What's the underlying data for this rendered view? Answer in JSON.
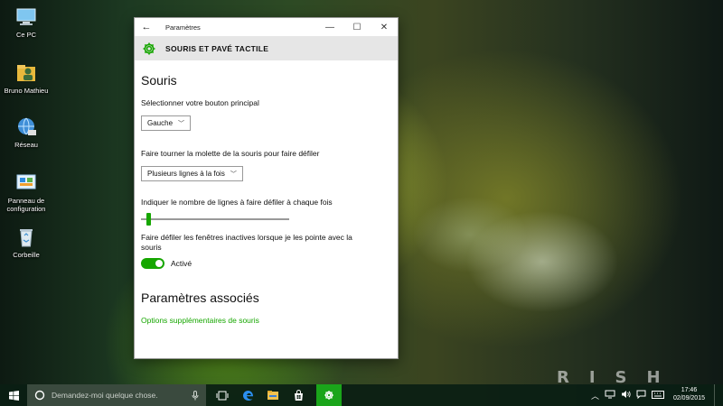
{
  "desktop": {
    "icons": [
      {
        "label": "Ce PC",
        "icon": "computer-icon"
      },
      {
        "label": "Bruno Mathieu",
        "icon": "user-folder-icon"
      },
      {
        "label": "Réseau",
        "icon": "network-icon"
      },
      {
        "label": "Panneau de configuration",
        "icon": "control-panel-icon"
      },
      {
        "label": "Corbeille",
        "icon": "recycle-bin-icon"
      }
    ],
    "watermark": "RISH"
  },
  "window": {
    "title": "Paramètres",
    "controls": {
      "minimize": "—",
      "maximize": "☐",
      "close": "✕"
    },
    "back": "←",
    "header_title": "SOURIS ET PAVÉ TACTILE",
    "header_icon": "gear-icon",
    "section_title": "Souris",
    "primary_button": {
      "label": "Sélectionner votre bouton principal",
      "value": "Gauche"
    },
    "scroll_wheel": {
      "label": "Faire tourner la molette de la souris pour faire défiler",
      "value": "Plusieurs lignes à la fois"
    },
    "lines_slider": {
      "label": "Indiquer le nombre de lignes à faire défiler à chaque fois",
      "level": 0.02
    },
    "inactive_scroll": {
      "label": "Faire défiler les fenêtres inactives lorsque je les pointe avec la souris",
      "state": "Activé"
    },
    "related_title": "Paramètres associés",
    "related_link": "Options supplémentaires de souris"
  },
  "taskbar": {
    "search_placeholder": "Demandez-moi quelque chose.",
    "apps": [
      "task-view-icon",
      "edge-icon",
      "file-explorer-icon",
      "store-icon",
      "settings-icon"
    ],
    "active_app": "settings-icon",
    "time": "17:46",
    "date": "02/09/2015"
  },
  "colors": {
    "accent": "#16a600",
    "taskbar": "#0a1e14",
    "header_bg": "#e6e6e6"
  }
}
